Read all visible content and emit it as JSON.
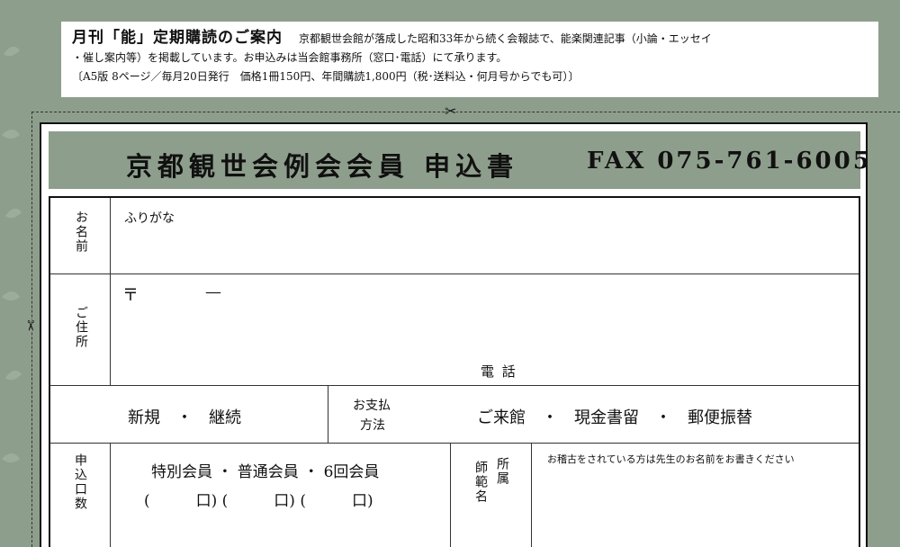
{
  "notice": {
    "title": "月刊「能」定期購読のご案内",
    "line1": "京都観世会館が落成した昭和33年から続く会報誌で、能楽関連記事（小論・エッセイ",
    "line2": "・催し案内等）を掲載しています。お申込みは当会館事務所（窓口･電話）にて承ります。",
    "line3": "〔A5版 8ページ／毎月20日発行　価格1冊150円、年間購読1,800円（税･送料込・何月号からでも可）〕"
  },
  "form": {
    "title": "京都観世会例会会員 申込書",
    "fax": "FAX 075-761-6005",
    "name_label": "お名前",
    "furigana": "ふりがな",
    "address_label": "ご住所",
    "postal_mark": "〒",
    "postal_dash": "—",
    "phone_label": "電 話",
    "new_renew": "新規　・　継続",
    "payment_label_1": "お支払",
    "payment_label_2": "方法",
    "payment_options": "ご来館　・　現金書留　・　郵便振替",
    "count_label": "申込口数",
    "member_types": "特別会員 ・ 普通会員 ・ 6回会員",
    "member_units": "(　　　口)  (　　　口)  (　　　口)",
    "teacher_label_1": "所属",
    "teacher_label_2": "師範名",
    "teacher_note": "お稽古をされている方は先生のお名前をお書きください"
  },
  "icons": {
    "scissors": "✂"
  },
  "colors": {
    "background": "#8e9e8c",
    "header_band": "#8e9e8c",
    "paper": "#ffffff"
  }
}
